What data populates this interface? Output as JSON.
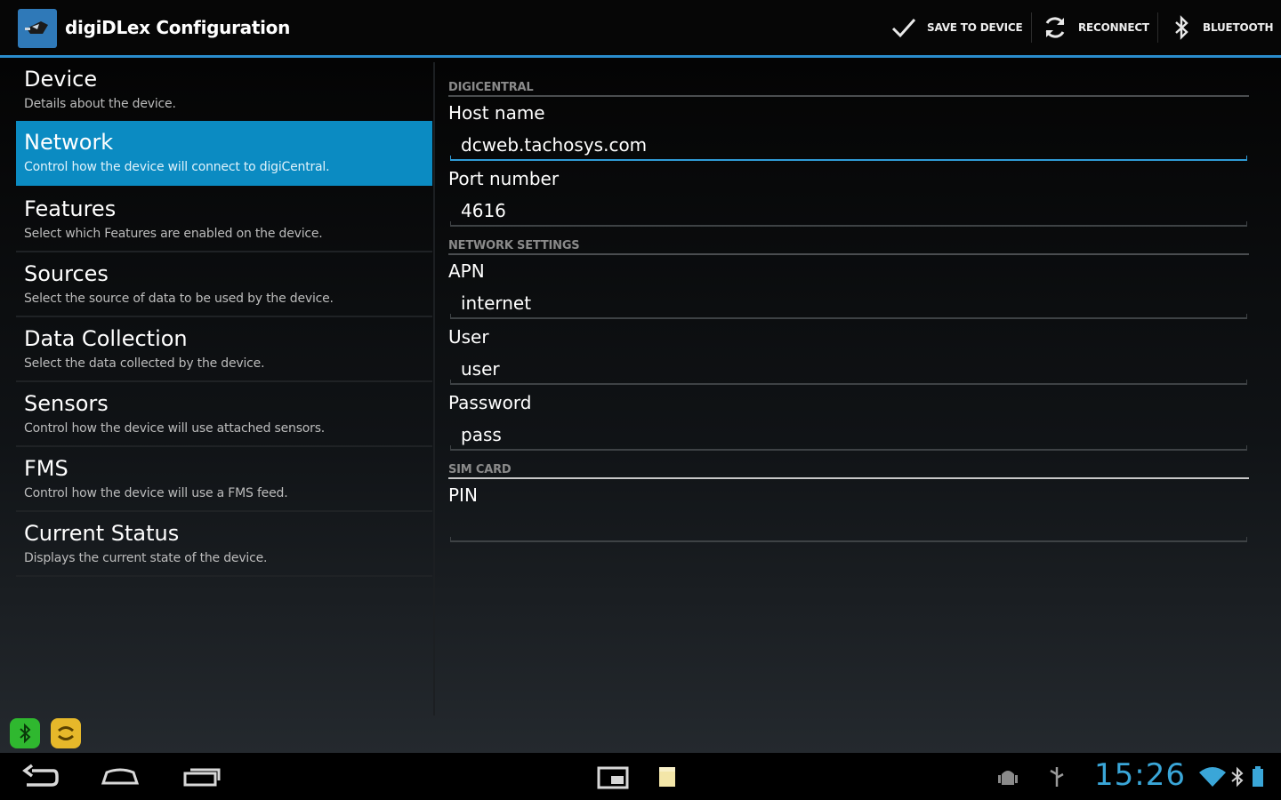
{
  "app": {
    "title": "digiDLex Configuration"
  },
  "actions": {
    "save": "SAVE TO DEVICE",
    "reconnect": "RECONNECT",
    "bluetooth": "BLUETOOTH"
  },
  "nav_items": [
    {
      "title": "Device",
      "summary": "Details about the device."
    },
    {
      "title": "Network",
      "summary": "Control how the device will connect to digiCentral."
    },
    {
      "title": "Features",
      "summary": "Select which Features are enabled on the device."
    },
    {
      "title": "Sources",
      "summary": "Select the source of data to be used by the device."
    },
    {
      "title": "Data Collection",
      "summary": "Select the data collected by the device."
    },
    {
      "title": "Sensors",
      "summary": "Control how the device will use attached sensors."
    },
    {
      "title": "FMS",
      "summary": "Control how the device will use a FMS feed."
    },
    {
      "title": "Current Status",
      "summary": "Displays the current state of the device."
    }
  ],
  "form": {
    "section_digicentral": "DIGICENTRAL",
    "host_label": "Host name",
    "host_value": "dcweb.tachosys.com",
    "port_label": "Port number",
    "port_value": "4616",
    "section_network": "NETWORK SETTINGS",
    "apn_label": "APN",
    "apn_value": "internet",
    "user_label": "User",
    "user_value": "user",
    "password_label": "Password",
    "password_value": "pass",
    "section_sim": "SIM CARD",
    "pin_label": "PIN",
    "pin_value": ""
  },
  "status": {
    "time": "15:26"
  },
  "colors": {
    "accent": "#0b8bc2",
    "clock": "#3aa6d8",
    "focus_line": "#2f9bd6"
  }
}
